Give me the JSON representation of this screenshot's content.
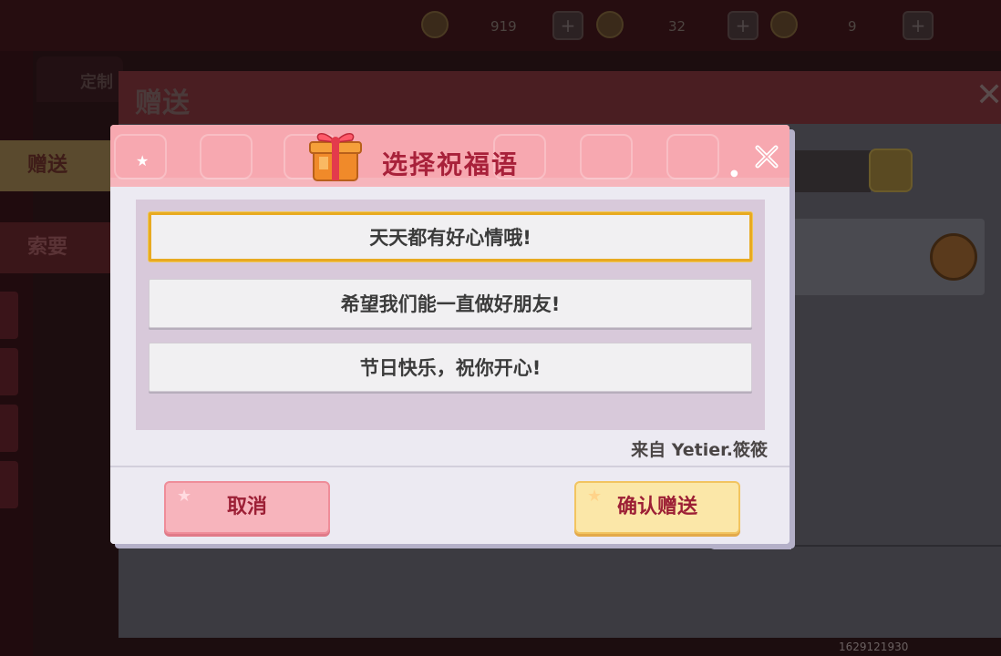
{
  "background": {
    "resources": [
      {
        "icon": "leaf-coin-icon",
        "value": "919"
      },
      {
        "icon": "gold-coin-icon",
        "value": "32"
      },
      {
        "icon": "blue-gem-icon",
        "value": "9"
      }
    ],
    "panel_title": "赠送",
    "back_tab_label": "定制",
    "side_tabs": {
      "give": "赠送",
      "ask": "索要"
    },
    "bottom_id": "1629121930"
  },
  "dialog": {
    "title": "选择祝福语",
    "messages": [
      {
        "text": "天天都有好心情哦!",
        "selected": true
      },
      {
        "text": "希望我们能一直做好朋友!",
        "selected": false
      },
      {
        "text": "节日快乐，祝你开心!",
        "selected": false
      }
    ],
    "from_label": "来自 Yetier.筱筱",
    "cancel_label": "取消",
    "confirm_label": "确认赠送"
  },
  "colors": {
    "header_pink": "#f7a8b0",
    "title_red": "#a8213a",
    "selected_border": "#e8aa22",
    "message_area": "#d8c9da"
  }
}
